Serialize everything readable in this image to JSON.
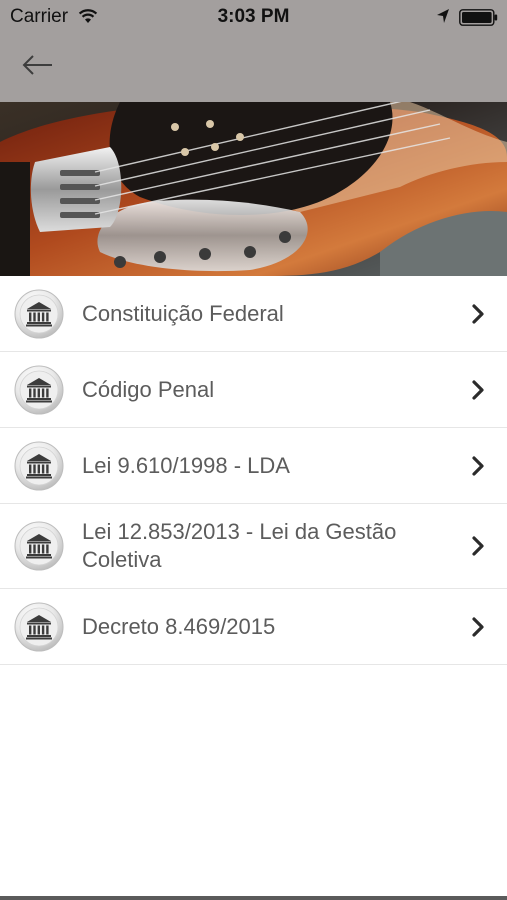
{
  "status_bar": {
    "carrier": "Carrier",
    "time": "3:03 PM"
  },
  "nav": {
    "back_icon": "left-arrow-icon",
    "bar_color": "#a39f9e"
  },
  "hero": {
    "image": "bass-guitar-photo"
  },
  "list": {
    "items": [
      {
        "label": "Constituição Federal",
        "icon": "courthouse-icon"
      },
      {
        "label": "Código Penal",
        "icon": "courthouse-icon"
      },
      {
        "label": "Lei 9.610/1998 - LDA",
        "icon": "courthouse-icon"
      },
      {
        "label": "Lei 12.853/2013 - Lei da Gestão Coletiva",
        "icon": "courthouse-icon"
      },
      {
        "label": "Decreto 8.469/2015",
        "icon": "courthouse-icon"
      }
    ]
  }
}
